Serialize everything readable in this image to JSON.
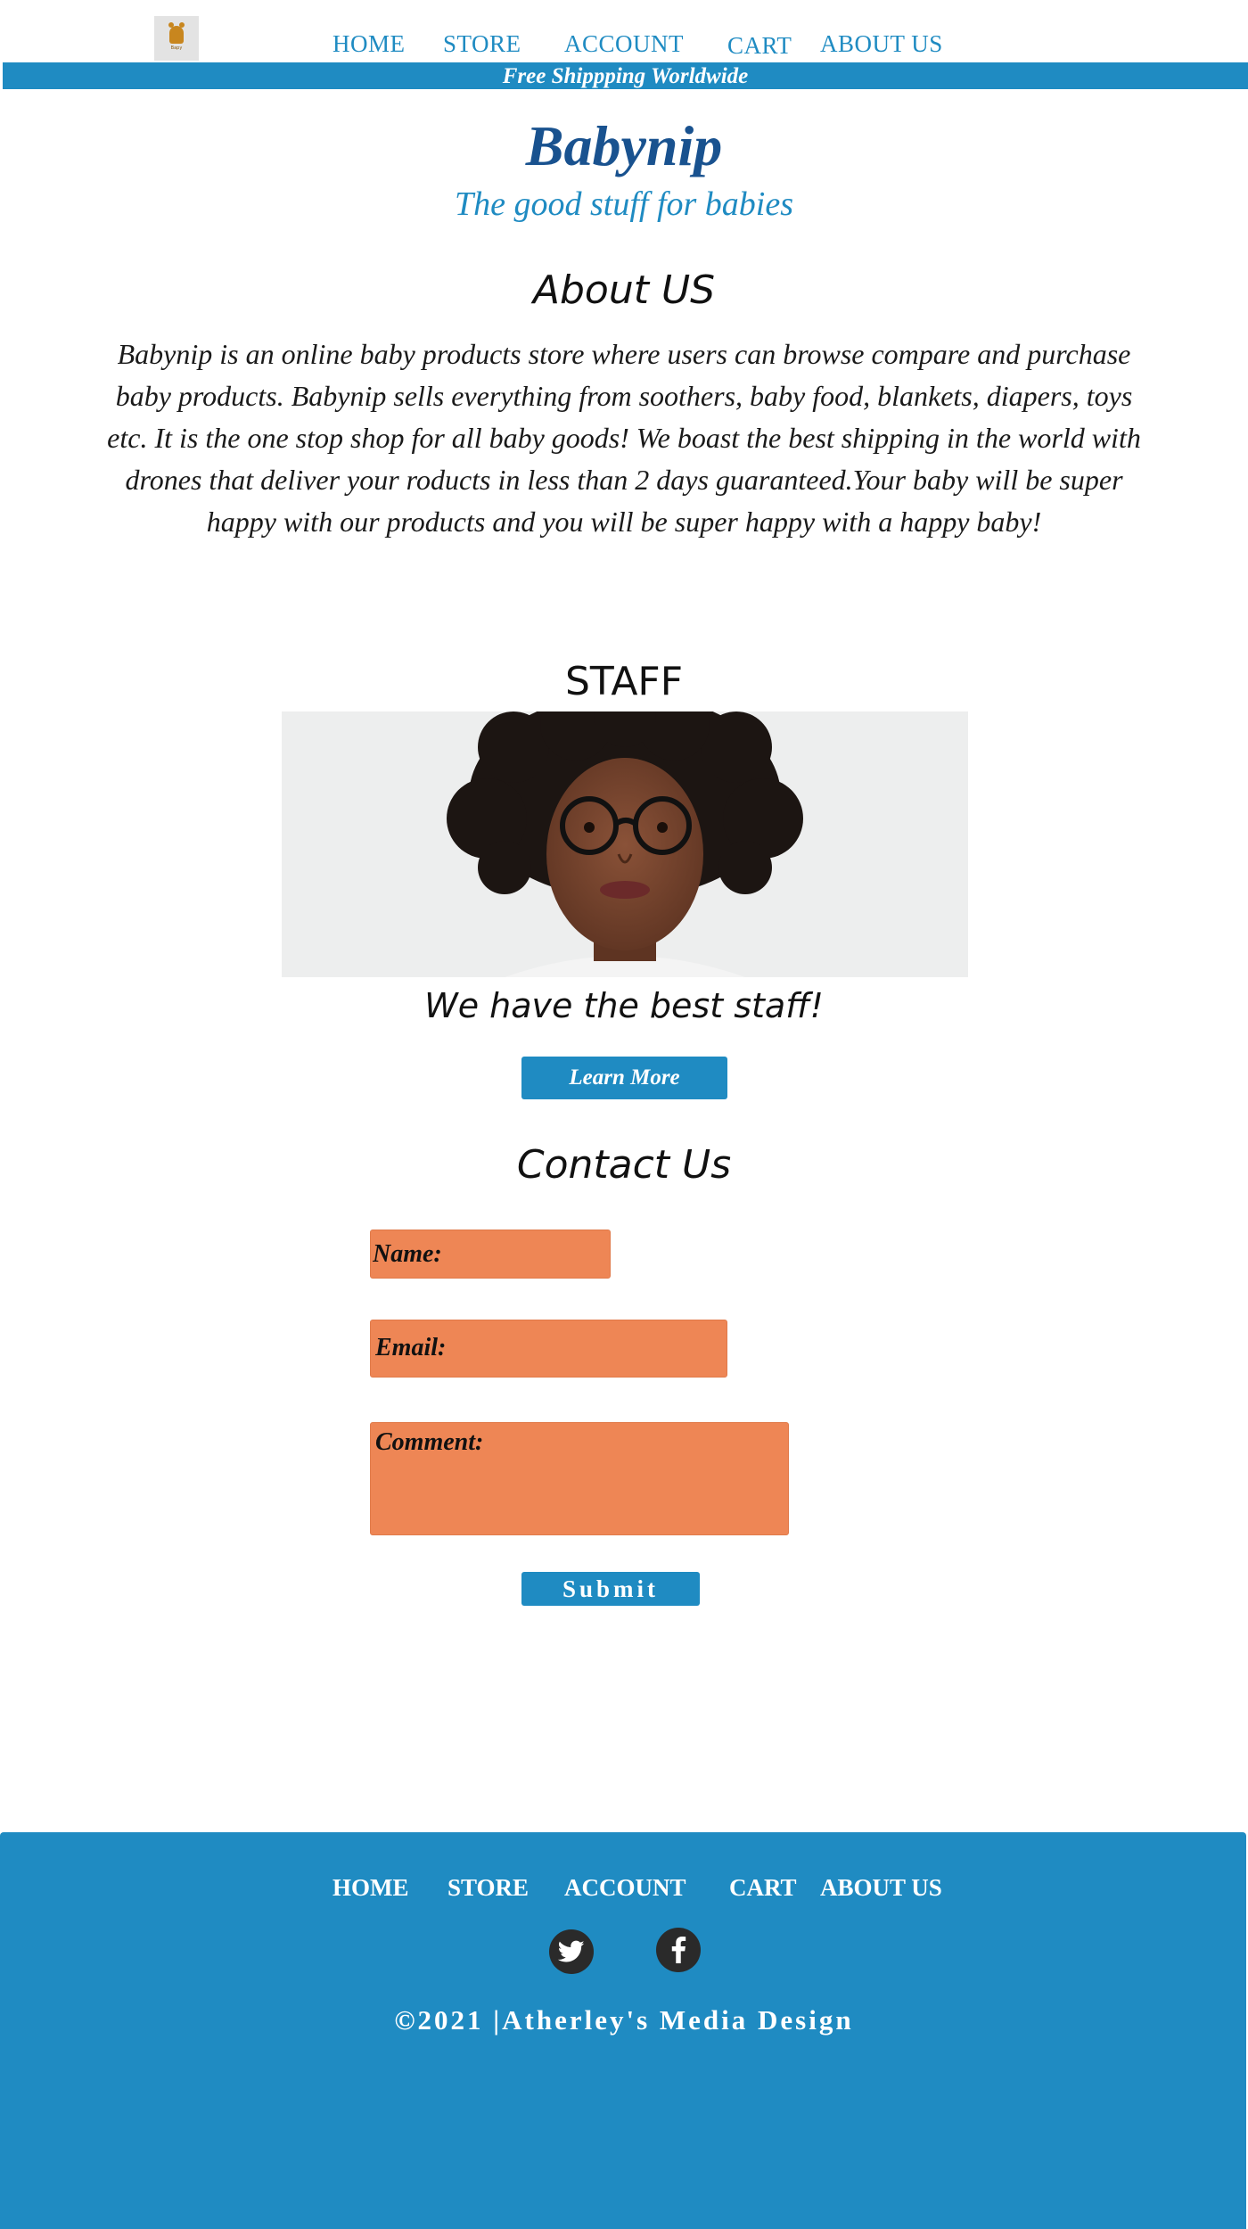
{
  "header": {
    "logo_text": "Bapy",
    "nav": [
      {
        "label": "HOME"
      },
      {
        "label": "STORE"
      },
      {
        "label": "ACCOUNT"
      },
      {
        "label": "CART"
      },
      {
        "label": "ABOUT US"
      }
    ],
    "banner": "Free Shippping Worldwide"
  },
  "hero": {
    "title": "Babynip",
    "tagline": "The good stuff for babies"
  },
  "about": {
    "heading": "About US",
    "text": "Babynip is an online baby products store where users can browse compare and purchase baby products. Babynip sells everything from soothers, baby food, blankets, diapers, toys etc. It is the one stop shop for all baby goods! We boast the best shipping in the world with drones that deliver your roducts in less than 2 days guaranteed.Your baby will be super happy with our products and you will be super happy with a happy baby!"
  },
  "staff": {
    "heading": "STAFF",
    "caption": "We have the best staff!",
    "button": "Learn More"
  },
  "contact": {
    "heading": "Contact Us",
    "name_placeholder": "Name:",
    "email_placeholder": "Email:",
    "comment_placeholder": "Comment:",
    "submit": "Submit"
  },
  "footer": {
    "nav": [
      {
        "label": "HOME"
      },
      {
        "label": "STORE"
      },
      {
        "label": "ACCOUNT"
      },
      {
        "label": "CART"
      },
      {
        "label": "ABOUT US"
      }
    ],
    "social": [
      "twitter-icon",
      "facebook-icon"
    ],
    "copyright": "©2021 |Atherley's Media Design"
  },
  "colors": {
    "primary_blue": "#1f8bc2",
    "title_blue": "#19528f",
    "form_orange": "#ee8655",
    "social_dark": "#2a2a2a"
  }
}
